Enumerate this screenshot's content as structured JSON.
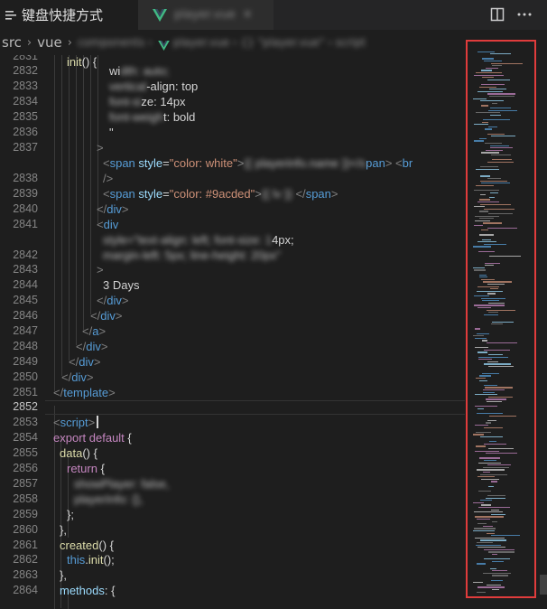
{
  "tabs": [
    {
      "label": "键盘快捷方式",
      "icon": "list-icon",
      "active": true
    },
    {
      "label": "player.vue",
      "icon": "vue-icon",
      "active": false,
      "blurred": true
    }
  ],
  "toolbar": {
    "split_icon": "split-editor-icon",
    "more_icon": "more-actions-icon"
  },
  "breadcrumb": [
    "src",
    "vue"
  ],
  "editor": {
    "first_line": 2831,
    "current_line": 2852,
    "line_numbers": [
      "2831",
      "2832",
      "2833",
      "2834",
      "2835",
      "2836",
      "2837",
      "",
      "2838",
      "2839",
      "2840",
      "2841",
      "",
      "2842",
      "2843",
      "2844",
      "2845",
      "2846",
      "2847",
      "2848",
      "2849",
      "2850",
      "2851",
      "2852",
      "2853",
      "2854",
      "2855",
      "2856",
      "2857",
      "2858",
      "2859",
      "2860",
      "2861",
      "2862",
      "2863",
      "2864"
    ],
    "code": [
      {
        "indent": 0,
        "tokens": []
      },
      {
        "indent": 121,
        "tokens": [
          [
            "t-text",
            "wi"
          ],
          [
            "t-blur",
            "dth: auto;"
          ]
        ]
      },
      {
        "indent": 121,
        "tokens": [
          [
            "t-blur",
            "vertical"
          ],
          [
            "t-text",
            "-align: top"
          ]
        ]
      },
      {
        "indent": 121,
        "tokens": [
          [
            "t-blur",
            "font-si"
          ],
          [
            "t-text",
            "ze: 14px"
          ]
        ]
      },
      {
        "indent": 121,
        "tokens": [
          [
            "t-blur",
            "font-weigh"
          ],
          [
            "t-text",
            "t: bold"
          ]
        ]
      },
      {
        "indent": 121,
        "tokens": [
          [
            "t-text",
            "\""
          ]
        ]
      },
      {
        "indent": 107,
        "tokens": [
          [
            "t-punc",
            ">"
          ]
        ]
      },
      {
        "indent": 114,
        "tokens": [
          [
            "t-punc",
            "<"
          ],
          [
            "t-tag",
            "span"
          ],
          [
            "t-text",
            " "
          ],
          [
            "t-attr",
            "style"
          ],
          [
            "t-text",
            "="
          ],
          [
            "t-str",
            "\"color: white\""
          ],
          [
            "t-punc",
            ">"
          ],
          [
            "t-blur",
            "{{ playerinfo.name }}</s"
          ],
          [
            "t-tag",
            "pan"
          ],
          [
            "t-punc",
            ">"
          ],
          [
            "t-text",
            " "
          ],
          [
            "t-punc",
            "<"
          ],
          [
            "t-tag",
            "br"
          ]
        ]
      },
      {
        "indent": 114,
        "tokens": [
          [
            "t-punc",
            "/>"
          ]
        ]
      },
      {
        "indent": 114,
        "tokens": [
          [
            "t-punc",
            "<"
          ],
          [
            "t-tag",
            "span"
          ],
          [
            "t-text",
            " "
          ],
          [
            "t-attr",
            "style"
          ],
          [
            "t-text",
            "="
          ],
          [
            "t-str",
            "\"color: #9acded\""
          ],
          [
            "t-punc",
            ">"
          ],
          [
            "t-blur",
            "{{ lv }}"
          ],
          [
            "t-text",
            " "
          ],
          [
            "t-punc",
            "</"
          ],
          [
            "t-tag",
            "span"
          ],
          [
            "t-punc",
            ">"
          ]
        ]
      },
      {
        "indent": 107,
        "tokens": [
          [
            "t-punc",
            "</"
          ],
          [
            "t-tag",
            "div"
          ],
          [
            "t-punc",
            ">"
          ]
        ]
      },
      {
        "indent": 107,
        "tokens": [
          [
            "t-punc",
            "<"
          ],
          [
            "t-tag",
            "div"
          ]
        ]
      },
      {
        "indent": 114,
        "tokens": [
          [
            "t-blur",
            "style=\"text-align: left; font-size: 1"
          ],
          [
            "t-text",
            "4px;"
          ]
        ]
      },
      {
        "indent": 114,
        "tokens": [
          [
            "t-blur",
            "margin-left: 5px; line-height: 20px\""
          ]
        ]
      },
      {
        "indent": 107,
        "tokens": [
          [
            "t-punc",
            ">"
          ]
        ]
      },
      {
        "indent": 114,
        "tokens": [
          [
            "t-text",
            "3 Days"
          ]
        ]
      },
      {
        "indent": 107,
        "tokens": [
          [
            "t-punc",
            "</"
          ],
          [
            "t-tag",
            "div"
          ],
          [
            "t-punc",
            ">"
          ]
        ]
      },
      {
        "indent": 100,
        "tokens": [
          [
            "t-punc",
            "</"
          ],
          [
            "t-tag",
            "div"
          ],
          [
            "t-punc",
            ">"
          ]
        ]
      },
      {
        "indent": 91,
        "tokens": [
          [
            "t-punc",
            "</"
          ],
          [
            "t-tag",
            "a"
          ],
          [
            "t-punc",
            ">"
          ]
        ]
      },
      {
        "indent": 84,
        "tokens": [
          [
            "t-punc",
            "</"
          ],
          [
            "t-tag",
            "div"
          ],
          [
            "t-punc",
            ">"
          ]
        ]
      },
      {
        "indent": 76,
        "tokens": [
          [
            "t-punc",
            "</"
          ],
          [
            "t-tag",
            "div"
          ],
          [
            "t-punc",
            ">"
          ]
        ]
      },
      {
        "indent": 68,
        "tokens": [
          [
            "t-punc",
            "</"
          ],
          [
            "t-tag",
            "div"
          ],
          [
            "t-punc",
            ">"
          ]
        ]
      },
      {
        "indent": 59,
        "tokens": [
          [
            "t-punc",
            "</"
          ],
          [
            "t-tag",
            "template"
          ],
          [
            "t-punc",
            ">"
          ]
        ]
      },
      {
        "indent": 0,
        "tokens": []
      },
      {
        "indent": 59,
        "tokens": [
          [
            "t-punc",
            "<"
          ],
          [
            "t-tag",
            "script"
          ],
          [
            "t-punc",
            ">"
          ]
        ],
        "caret": true
      },
      {
        "indent": 59,
        "tokens": [
          [
            "t-kw",
            "export"
          ],
          [
            "t-text",
            " "
          ],
          [
            "t-kw",
            "default"
          ],
          [
            "t-text",
            " {"
          ]
        ]
      },
      {
        "indent": 66,
        "tokens": [
          [
            "t-fn",
            "data"
          ],
          [
            "t-text",
            "() {"
          ]
        ]
      },
      {
        "indent": 74,
        "tokens": [
          [
            "t-kw",
            "return"
          ],
          [
            "t-text",
            " {"
          ]
        ]
      },
      {
        "indent": 82,
        "tokens": [
          [
            "t-blur",
            "showPlayer: false,"
          ]
        ]
      },
      {
        "indent": 82,
        "tokens": [
          [
            "t-blur",
            "playerInfo: {},"
          ]
        ]
      },
      {
        "indent": 74,
        "tokens": [
          [
            "t-text",
            "};"
          ]
        ]
      },
      {
        "indent": 66,
        "tokens": [
          [
            "t-text",
            "},"
          ]
        ]
      },
      {
        "indent": 66,
        "tokens": [
          [
            "t-fn",
            "created"
          ],
          [
            "t-text",
            "() {"
          ]
        ]
      },
      {
        "indent": 74,
        "tokens": [
          [
            "t-this",
            "this"
          ],
          [
            "t-text",
            "."
          ],
          [
            "t-fn",
            "init"
          ],
          [
            "t-text",
            "();"
          ]
        ]
      },
      {
        "indent": 66,
        "tokens": [
          [
            "t-text",
            "},"
          ]
        ]
      },
      {
        "indent": 66,
        "tokens": [
          [
            "t-var",
            "methods"
          ],
          [
            "t-text",
            ": {"
          ]
        ]
      },
      {
        "indent": 74,
        "tokens": [
          [
            "t-fn",
            "init"
          ],
          [
            "t-text",
            "() {"
          ]
        ]
      }
    ]
  },
  "minimap": {
    "highlight_color": "#e03c3c"
  }
}
